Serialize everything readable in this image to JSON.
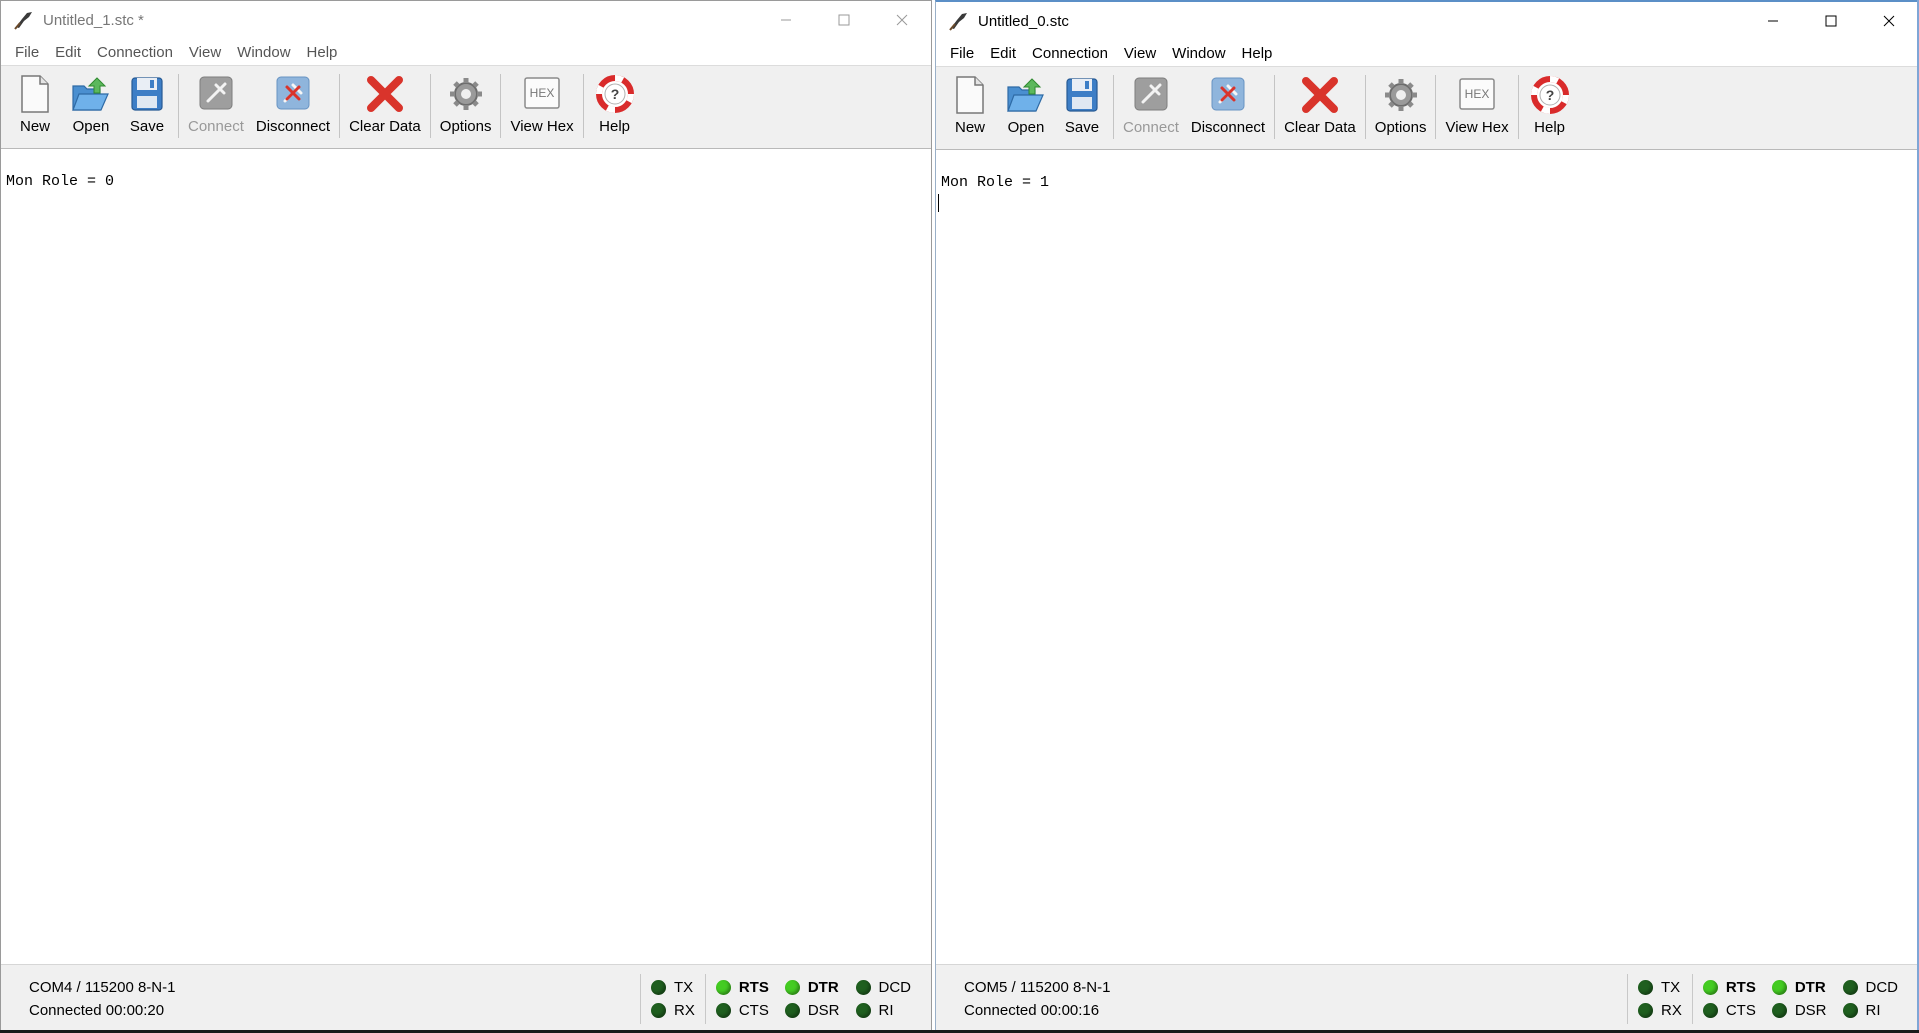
{
  "colors": {
    "led_dark": "#1f5f1f",
    "led_bright": "#44cc22",
    "toolbar_bg": "#f0f0f0",
    "clear_red": "#d9342b",
    "help_red": "#d92b2b"
  },
  "windows": [
    {
      "title": "Untitled_1.stc *",
      "menu": [
        "File",
        "Edit",
        "Connection",
        "View",
        "Window",
        "Help"
      ],
      "toolbar": [
        {
          "label": "New",
          "icon": "new-file-icon",
          "enabled": true
        },
        {
          "label": "Open",
          "icon": "open-folder-icon",
          "enabled": true
        },
        {
          "label": "Save",
          "icon": "save-disk-icon",
          "enabled": true
        },
        {
          "label": "Connect",
          "icon": "connect-plug-icon",
          "enabled": false
        },
        {
          "label": "Disconnect",
          "icon": "disconnect-plug-icon",
          "enabled": true
        },
        {
          "label": "Clear Data",
          "icon": "clear-x-icon",
          "enabled": true
        },
        {
          "label": "Options",
          "icon": "options-gear-icon",
          "enabled": true
        },
        {
          "label": "View Hex",
          "icon": "hex-icon",
          "enabled": true
        },
        {
          "label": "Help",
          "icon": "help-lifebuoy-icon",
          "enabled": true
        }
      ],
      "hex_icon_text": "HEX",
      "terminal_text": "Mon Role = 0",
      "status": {
        "port": "COM4 / 115200 8-N-1",
        "connection": "Connected 00:00:20"
      },
      "signals": {
        "tx": "TX",
        "rx": "RX",
        "rts": "RTS",
        "cts": "CTS",
        "dtr": "DTR",
        "dsr": "DSR",
        "dcd": "DCD",
        "ri": "RI"
      }
    },
    {
      "title": "Untitled_0.stc",
      "menu": [
        "File",
        "Edit",
        "Connection",
        "View",
        "Window",
        "Help"
      ],
      "toolbar": [
        {
          "label": "New",
          "icon": "new-file-icon",
          "enabled": true
        },
        {
          "label": "Open",
          "icon": "open-folder-icon",
          "enabled": true
        },
        {
          "label": "Save",
          "icon": "save-disk-icon",
          "enabled": true
        },
        {
          "label": "Connect",
          "icon": "connect-plug-icon",
          "enabled": false
        },
        {
          "label": "Disconnect",
          "icon": "disconnect-plug-icon",
          "enabled": true
        },
        {
          "label": "Clear Data",
          "icon": "clear-x-icon",
          "enabled": true
        },
        {
          "label": "Options",
          "icon": "options-gear-icon",
          "enabled": true
        },
        {
          "label": "View Hex",
          "icon": "hex-icon",
          "enabled": true
        },
        {
          "label": "Help",
          "icon": "help-lifebuoy-icon",
          "enabled": true
        }
      ],
      "hex_icon_text": "HEX",
      "terminal_text": "Mon Role = 1",
      "status": {
        "port": "COM5 / 115200 8-N-1",
        "connection": "Connected 00:00:16"
      },
      "signals": {
        "tx": "TX",
        "rx": "RX",
        "rts": "RTS",
        "cts": "CTS",
        "dtr": "DTR",
        "dsr": "DSR",
        "dcd": "DCD",
        "ri": "RI"
      }
    }
  ]
}
